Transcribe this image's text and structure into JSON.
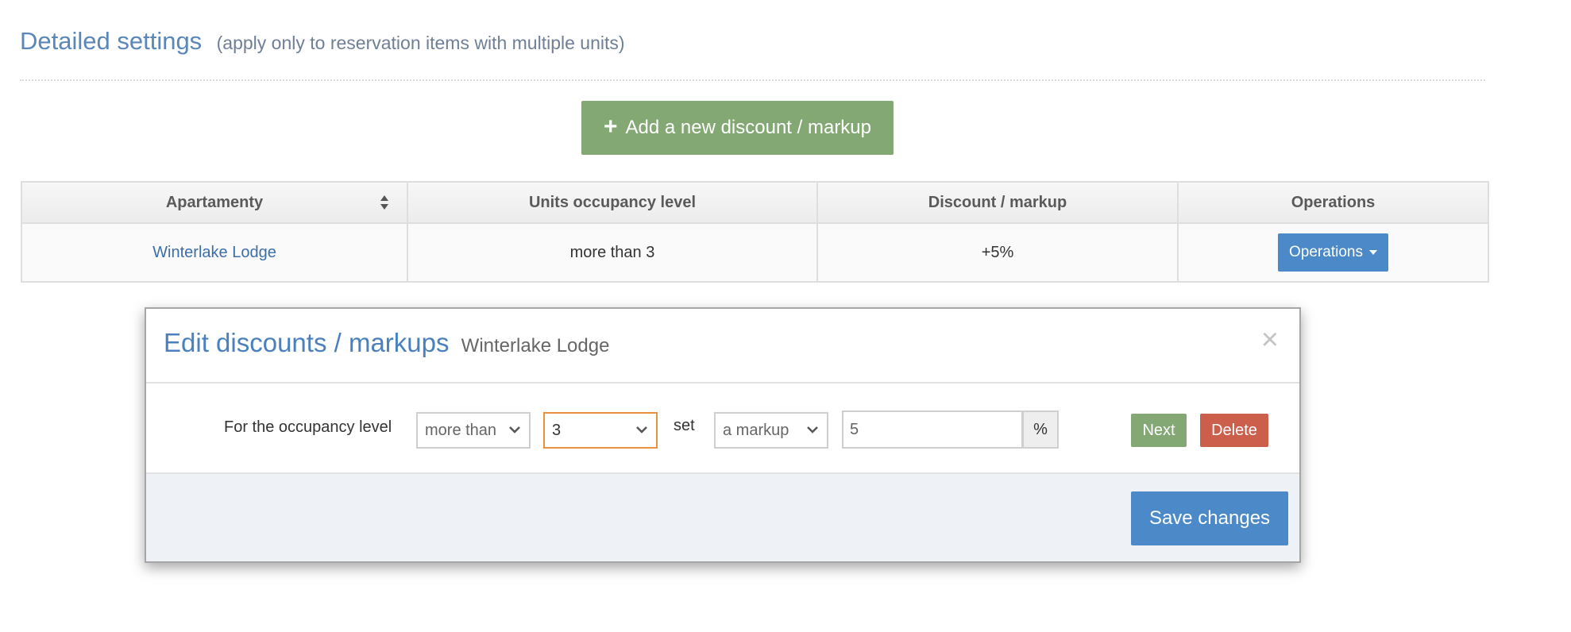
{
  "section": {
    "title": "Detailed settings",
    "note": "(apply only to reservation items with multiple units)",
    "add_button_label": "Add a new discount / markup",
    "add_icon": "plus-icon"
  },
  "table": {
    "headers": [
      "Apartamenty",
      "Units occupancy level",
      "Discount / markup",
      "Operations"
    ],
    "sort_icon": "sort-icon",
    "rows": [
      {
        "apartment": "Winterlake Lodge",
        "occupancy": "more than 3",
        "discount": "+5%",
        "operations_label": "Operations"
      }
    ]
  },
  "modal": {
    "title": "Edit discounts / markups",
    "subtitle": "Winterlake Lodge",
    "close_icon": "×",
    "occupancy_label": "For the occupancy level",
    "comparison_value": "more than",
    "level_value": "3",
    "set_label": "set",
    "type_value": "a markup",
    "amount_value": "5",
    "unit": "%",
    "next_label": "Next",
    "delete_label": "Delete",
    "save_label": "Save changes"
  },
  "colors": {
    "accent_blue": "#4b89c8",
    "success_green": "#84a874",
    "danger_red": "#cc5e4c",
    "focus_orange": "#e9913d"
  }
}
